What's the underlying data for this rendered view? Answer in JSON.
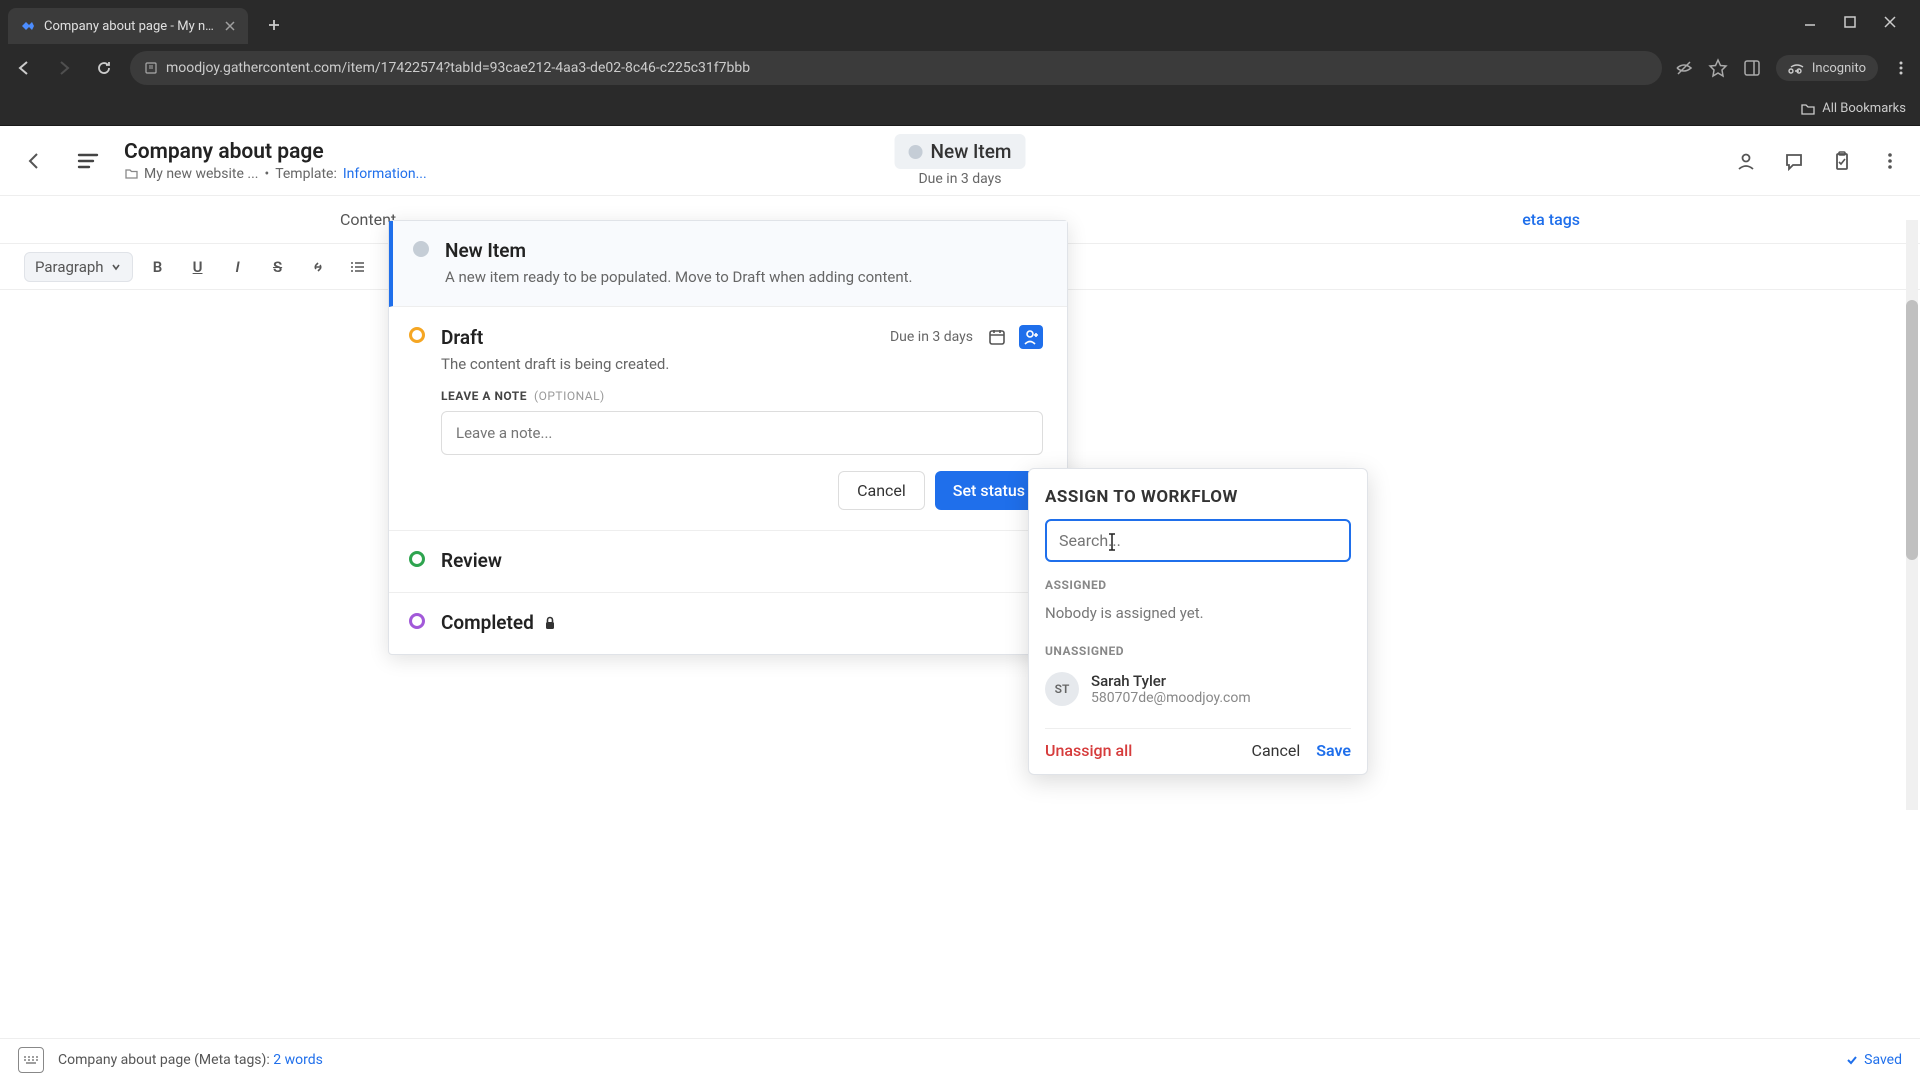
{
  "browser": {
    "tab_title": "Company about page - My ne...",
    "url": "moodjoy.gathercontent.com/item/17422574?tabId=93cae212-4aa3-de02-8c46-c225c31f7bbb",
    "incognito_label": "Incognito",
    "all_bookmarks": "All Bookmarks"
  },
  "header": {
    "title": "Company about page",
    "folder": "My new website ...",
    "template_prefix": "Template:",
    "template_link": "Information...",
    "status": "New Item",
    "due": "Due in 3 days"
  },
  "tabs": {
    "content": "Content",
    "meta": "eta tags"
  },
  "toolbar": {
    "paragraph": "Paragraph"
  },
  "workflow": {
    "steps": [
      {
        "title": "New Item",
        "desc": "A new item ready to be populated. Move to Draft when adding content."
      },
      {
        "title": "Draft",
        "desc": "The content draft is being created.",
        "due": "Due in 3 days"
      },
      {
        "title": "Review"
      },
      {
        "title": "Completed"
      }
    ],
    "note_label": "LEAVE A NOTE",
    "note_optional": "(OPTIONAL)",
    "note_placeholder": "Leave a note...",
    "cancel": "Cancel",
    "set_status": "Set status"
  },
  "assign_popup": {
    "title": "ASSIGN TO WORKFLOW",
    "search_placeholder": "Search...",
    "assigned_label": "ASSIGNED",
    "assigned_empty": "Nobody is assigned yet.",
    "unassigned_label": "UNASSIGNED",
    "user": {
      "initials": "ST",
      "name": "Sarah Tyler",
      "email": "580707de@moodjoy.com"
    },
    "unassign_all": "Unassign all",
    "cancel": "Cancel",
    "save": "Save"
  },
  "footer": {
    "doc": "Company about page (Meta tags):",
    "words": "2 words",
    "saved": "Saved"
  }
}
